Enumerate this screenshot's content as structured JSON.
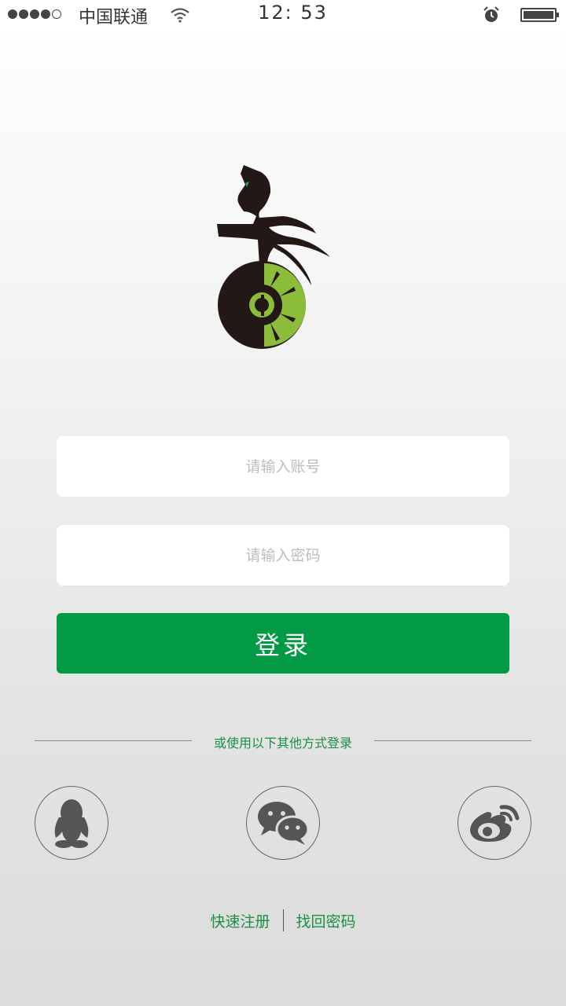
{
  "status_bar": {
    "carrier": "中国联通",
    "time": "12: 53"
  },
  "form": {
    "account_placeholder": "请输入账号",
    "password_placeholder": "请输入密码",
    "login_label": "登录"
  },
  "other_login": {
    "divider_text": "或使用以下其他方式登录",
    "providers": [
      {
        "name": "qq",
        "icon": "qq-penguin-icon"
      },
      {
        "name": "wechat",
        "icon": "wechat-bubbles-icon"
      },
      {
        "name": "weibo",
        "icon": "weibo-eye-icon"
      }
    ]
  },
  "links": {
    "register": "快速注册",
    "forgot": "找回密码"
  },
  "colors": {
    "primary_green": "#039a45",
    "link_green": "#1a8f45",
    "logo_lime": "#8bbd3a"
  }
}
